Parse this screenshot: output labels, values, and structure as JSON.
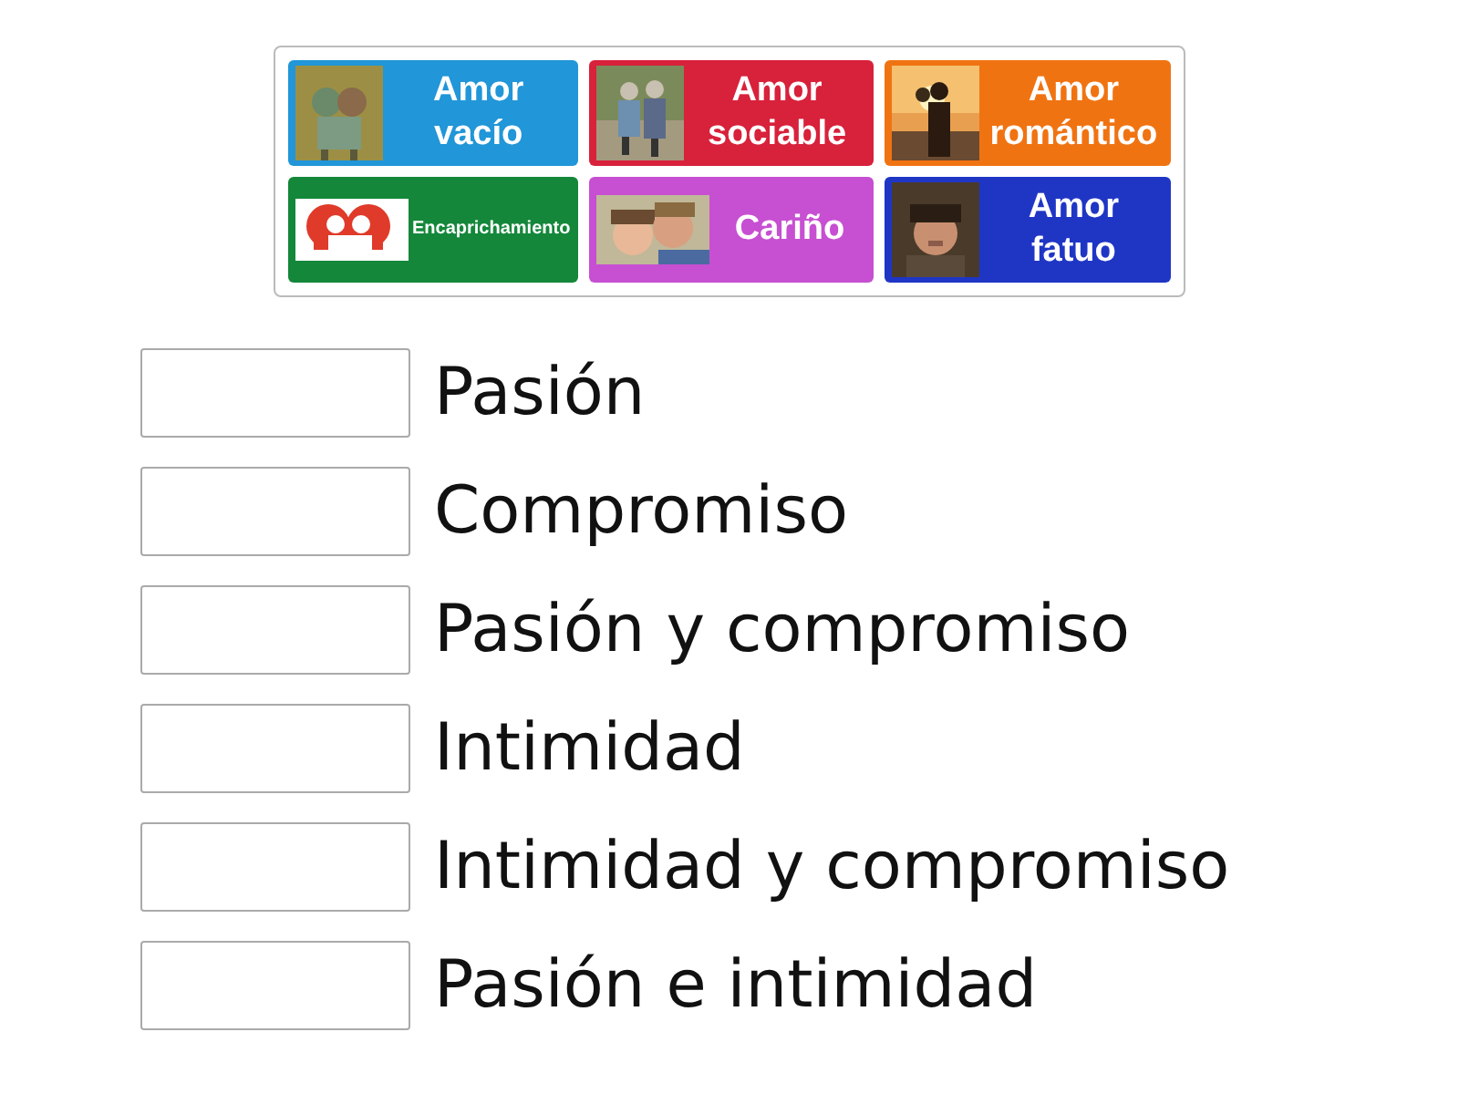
{
  "cards": [
    {
      "label": "Amor vacío",
      "color": "#2196d8"
    },
    {
      "label": "Amor sociable",
      "color": "#d8213b"
    },
    {
      "label": "Amor romántico",
      "color": "#f07312"
    },
    {
      "label": "Encaprichamiento",
      "color": "#14873a"
    },
    {
      "label": "Cariño",
      "color": "#c74fd2"
    },
    {
      "label": "Amor fatuo",
      "color": "#1f36c5"
    }
  ],
  "targets": [
    {
      "label": "Pasión"
    },
    {
      "label": "Compromiso"
    },
    {
      "label": "Pasión y compromiso"
    },
    {
      "label": "Intimidad"
    },
    {
      "label": "Intimidad y compromiso"
    },
    {
      "label": "Pasión e intimidad"
    }
  ]
}
